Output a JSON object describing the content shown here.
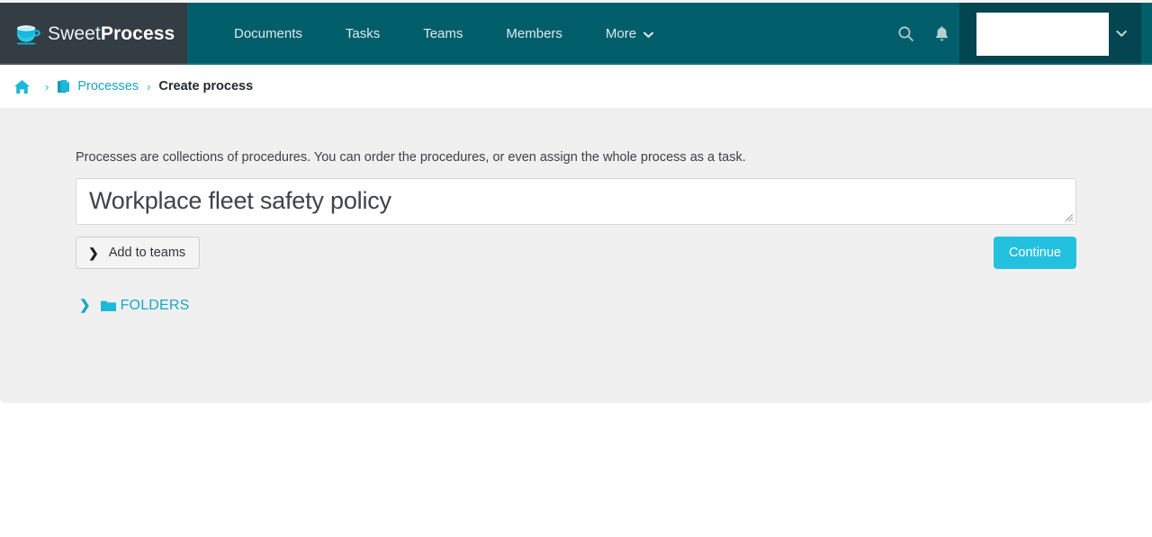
{
  "brand": {
    "name_light": "Sweet",
    "name_bold": "Process",
    "logo_icon": "coffee-cup-icon",
    "logo_bg": "#343c44",
    "nav_bg": "#005e6b",
    "user_bg": "#034550",
    "accent": "#18a7c6",
    "button_accent": "#24c0e0"
  },
  "nav": {
    "items": [
      {
        "label": "Documents"
      },
      {
        "label": "Tasks"
      },
      {
        "label": "Teams"
      },
      {
        "label": "Members"
      },
      {
        "label": "More",
        "caret": "⌄"
      }
    ],
    "search_icon": "search-icon",
    "notifications_icon": "bell-icon",
    "user_caret": "⌄"
  },
  "breadcrumb": {
    "home_icon": "home-icon",
    "processes_icon": "documents-icon",
    "separator": "›",
    "processes_label": "Processes",
    "current_label": "Create process"
  },
  "main": {
    "lead_text": "Processes are collections of procedures. You can order the procedures, or even assign the whole process as a task.",
    "title_value": "Workplace fleet safety policy",
    "title_placeholder": "Title",
    "add_to_teams_label": "Add to teams",
    "add_to_teams_chevron": "❯",
    "continue_label": "Continue",
    "folders_label": "FOLDERS",
    "folders_chevron": "❯",
    "folders_icon": "folder-icon"
  }
}
